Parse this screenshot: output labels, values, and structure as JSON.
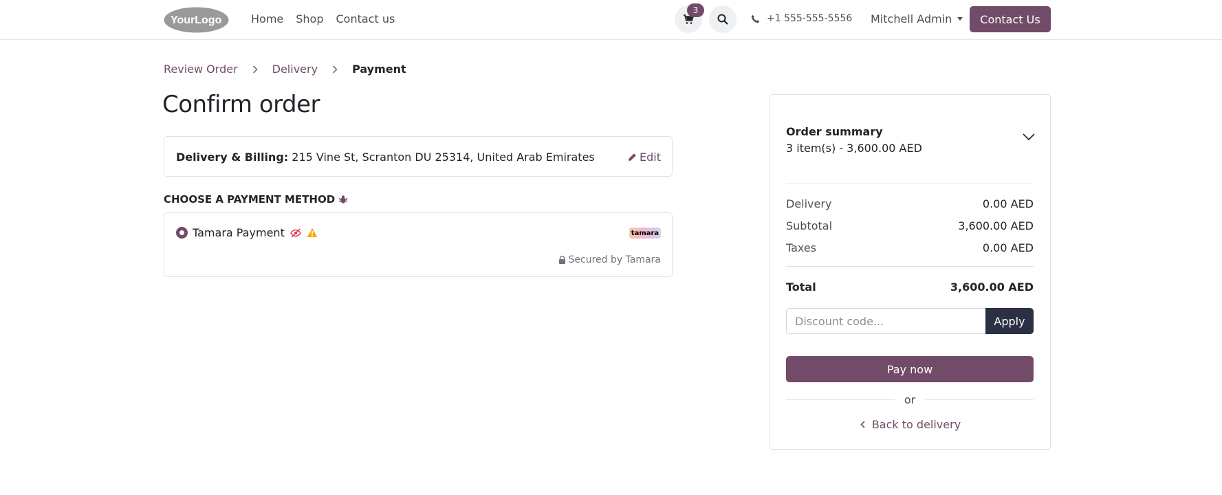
{
  "header": {
    "logo_text": "YourLogo",
    "nav": [
      "Home",
      "Shop",
      "Contact us"
    ],
    "cart_count": "3",
    "phone": "+1 555-555-5556",
    "user": "Mitchell Admin",
    "contact_button": "Contact Us"
  },
  "breadcrumb": {
    "steps": [
      "Review Order",
      "Delivery",
      "Payment"
    ]
  },
  "page_title": "Confirm order",
  "address": {
    "label": "Delivery & Billing:",
    "value": "215 Vine St, Scranton DU 25314, United Arab Emirates",
    "edit_label": "Edit"
  },
  "payment": {
    "heading": "CHOOSE A PAYMENT METHOD",
    "method_name": "Tamara Payment",
    "provider_logo_text": "tamara",
    "secured_text": "Secured by Tamara"
  },
  "summary": {
    "title": "Order summary",
    "items_line": "3 item(s) -  3,600.00 AED",
    "rows": [
      {
        "label": "Delivery",
        "value": "0.00 AED"
      },
      {
        "label": "Subtotal",
        "value": "3,600.00 AED"
      },
      {
        "label": "Taxes",
        "value": "0.00 AED"
      }
    ],
    "total_label": "Total",
    "total_value": "3,600.00 AED",
    "discount_placeholder": "Discount code...",
    "apply_label": "Apply",
    "pay_label": "Pay now",
    "or_label": "or",
    "back_label": "Back to delivery"
  },
  "colors": {
    "brand": "#714b67",
    "dark_button": "#2b3043"
  }
}
